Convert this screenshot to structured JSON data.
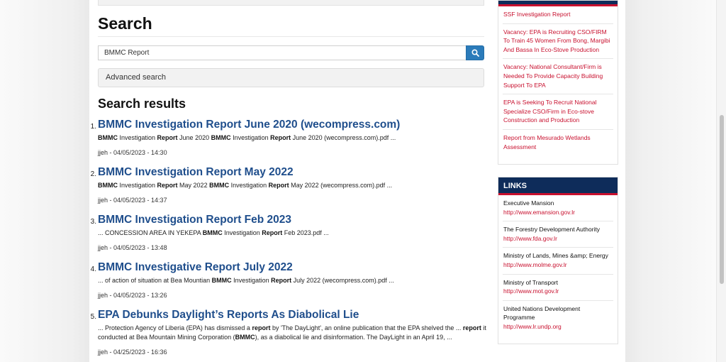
{
  "page": {
    "title": "Search",
    "results_heading": "Search results",
    "advanced_search_label": "Advanced search"
  },
  "search": {
    "value": "BMMC Report",
    "button_icon": "search-icon"
  },
  "results": [
    {
      "num": "1.",
      "title": "BMMC Investigation Report June 2020 (wecompress.com)",
      "snippet": [
        {
          "t": "BMMC",
          "b": true
        },
        {
          "t": " Investigation ",
          "b": false
        },
        {
          "t": "Report",
          "b": true
        },
        {
          "t": " June 2020   ",
          "b": false
        },
        {
          "t": "BMMC",
          "b": true
        },
        {
          "t": " Investigation ",
          "b": false
        },
        {
          "t": "Report",
          "b": true
        },
        {
          "t": " June 2020 (wecompress.com).pdf ...",
          "b": false
        }
      ],
      "meta": "jjeh - 04/05/2023 - 14:30"
    },
    {
      "num": "2.",
      "title": "BMMC Investigation Report May 2022",
      "snippet": [
        {
          "t": "BMMC",
          "b": true
        },
        {
          "t": " Investigation ",
          "b": false
        },
        {
          "t": "Report",
          "b": true
        },
        {
          "t": " May 2022   ",
          "b": false
        },
        {
          "t": "BMMC",
          "b": true
        },
        {
          "t": " Investigation ",
          "b": false
        },
        {
          "t": "Report",
          "b": true
        },
        {
          "t": " May 2022 (wecompress.com).pdf ...",
          "b": false
        }
      ],
      "meta": "jjeh - 04/05/2023 - 14:37"
    },
    {
      "num": "3.",
      "title": "BMMC Investigation Report Feb 2023",
      "snippet": [
        {
          "t": "... CONCESSION AREA IN YEKEPA   ",
          "b": false
        },
        {
          "t": "BMMC",
          "b": true
        },
        {
          "t": " Investigation ",
          "b": false
        },
        {
          "t": "Report",
          "b": true
        },
        {
          "t": " Feb 2023.pdf ...",
          "b": false
        }
      ],
      "meta": "jjeh - 04/05/2023 - 13:48"
    },
    {
      "num": "4.",
      "title": "BMMC Investigative Report July 2022",
      "snippet": [
        {
          "t": "... of action of situation at Bea Mountian ",
          "b": false
        },
        {
          "t": "BMMC",
          "b": true
        },
        {
          "t": " Investigation ",
          "b": false
        },
        {
          "t": "Report",
          "b": true
        },
        {
          "t": " July 2022 (wecompress.com).pdf ...",
          "b": false
        }
      ],
      "meta": "jjeh - 04/05/2023 - 13:26"
    },
    {
      "num": "5.",
      "title": "EPA Debunks Daylight’s Reports As Diabolical Lie",
      "snippet": [
        {
          "t": "... Protection Agency of Liberia (EPA) has dismissed a ",
          "b": false
        },
        {
          "t": "report",
          "b": true
        },
        {
          "t": " by 'The DayLight', an online publication that the EPA shelved the ... ",
          "b": false
        },
        {
          "t": "report",
          "b": true
        },
        {
          "t": " it conducted at Bea Mountain Mining Corporation (",
          "b": false
        },
        {
          "t": "BMMC",
          "b": true
        },
        {
          "t": "), as a diabolical lie and disinformation. The DayLight in an April 19, ...",
          "b": false
        }
      ],
      "meta": "jjeh - 04/25/2023 - 16:36"
    }
  ],
  "sidebar": {
    "notices": [
      "SSF Investigation Report",
      "Vacancy: EPA is Recruiting CSO/FIRM To Train 45 Women From Bong, Margibi And Bassa In Eco-Stove Production",
      "Vacancy: National Consultant/Firm is Needed To Provide Capacity Building Support To EPA",
      "EPA is Seeking To Recruit National Specialize CSO/Firm in Eco-stove Construction and Production",
      "Report from Mesurado Wetlands Assessment"
    ],
    "links_heading": "LINKS",
    "links": [
      {
        "name": "Executive Mansion",
        "url": "http://www.emansion.gov.lr"
      },
      {
        "name": "The Forestry Development Authority",
        "url": "http://www.fda.gov.lr"
      },
      {
        "name": "Ministry of Lands, Mines &amp; Energy",
        "url": "http://www.molme.gov.lr"
      },
      {
        "name": "Ministry of Transport",
        "url": "http://www.mot.gov.lr"
      },
      {
        "name": "United Nations Development Programme",
        "url": "http://www.lr.undp.org"
      }
    ]
  },
  "colors": {
    "result_title": "#1f4e8c",
    "search_button": "#2b7bba",
    "sidebar_header": "#0e2c5a",
    "accent_red": "#c8102e"
  }
}
